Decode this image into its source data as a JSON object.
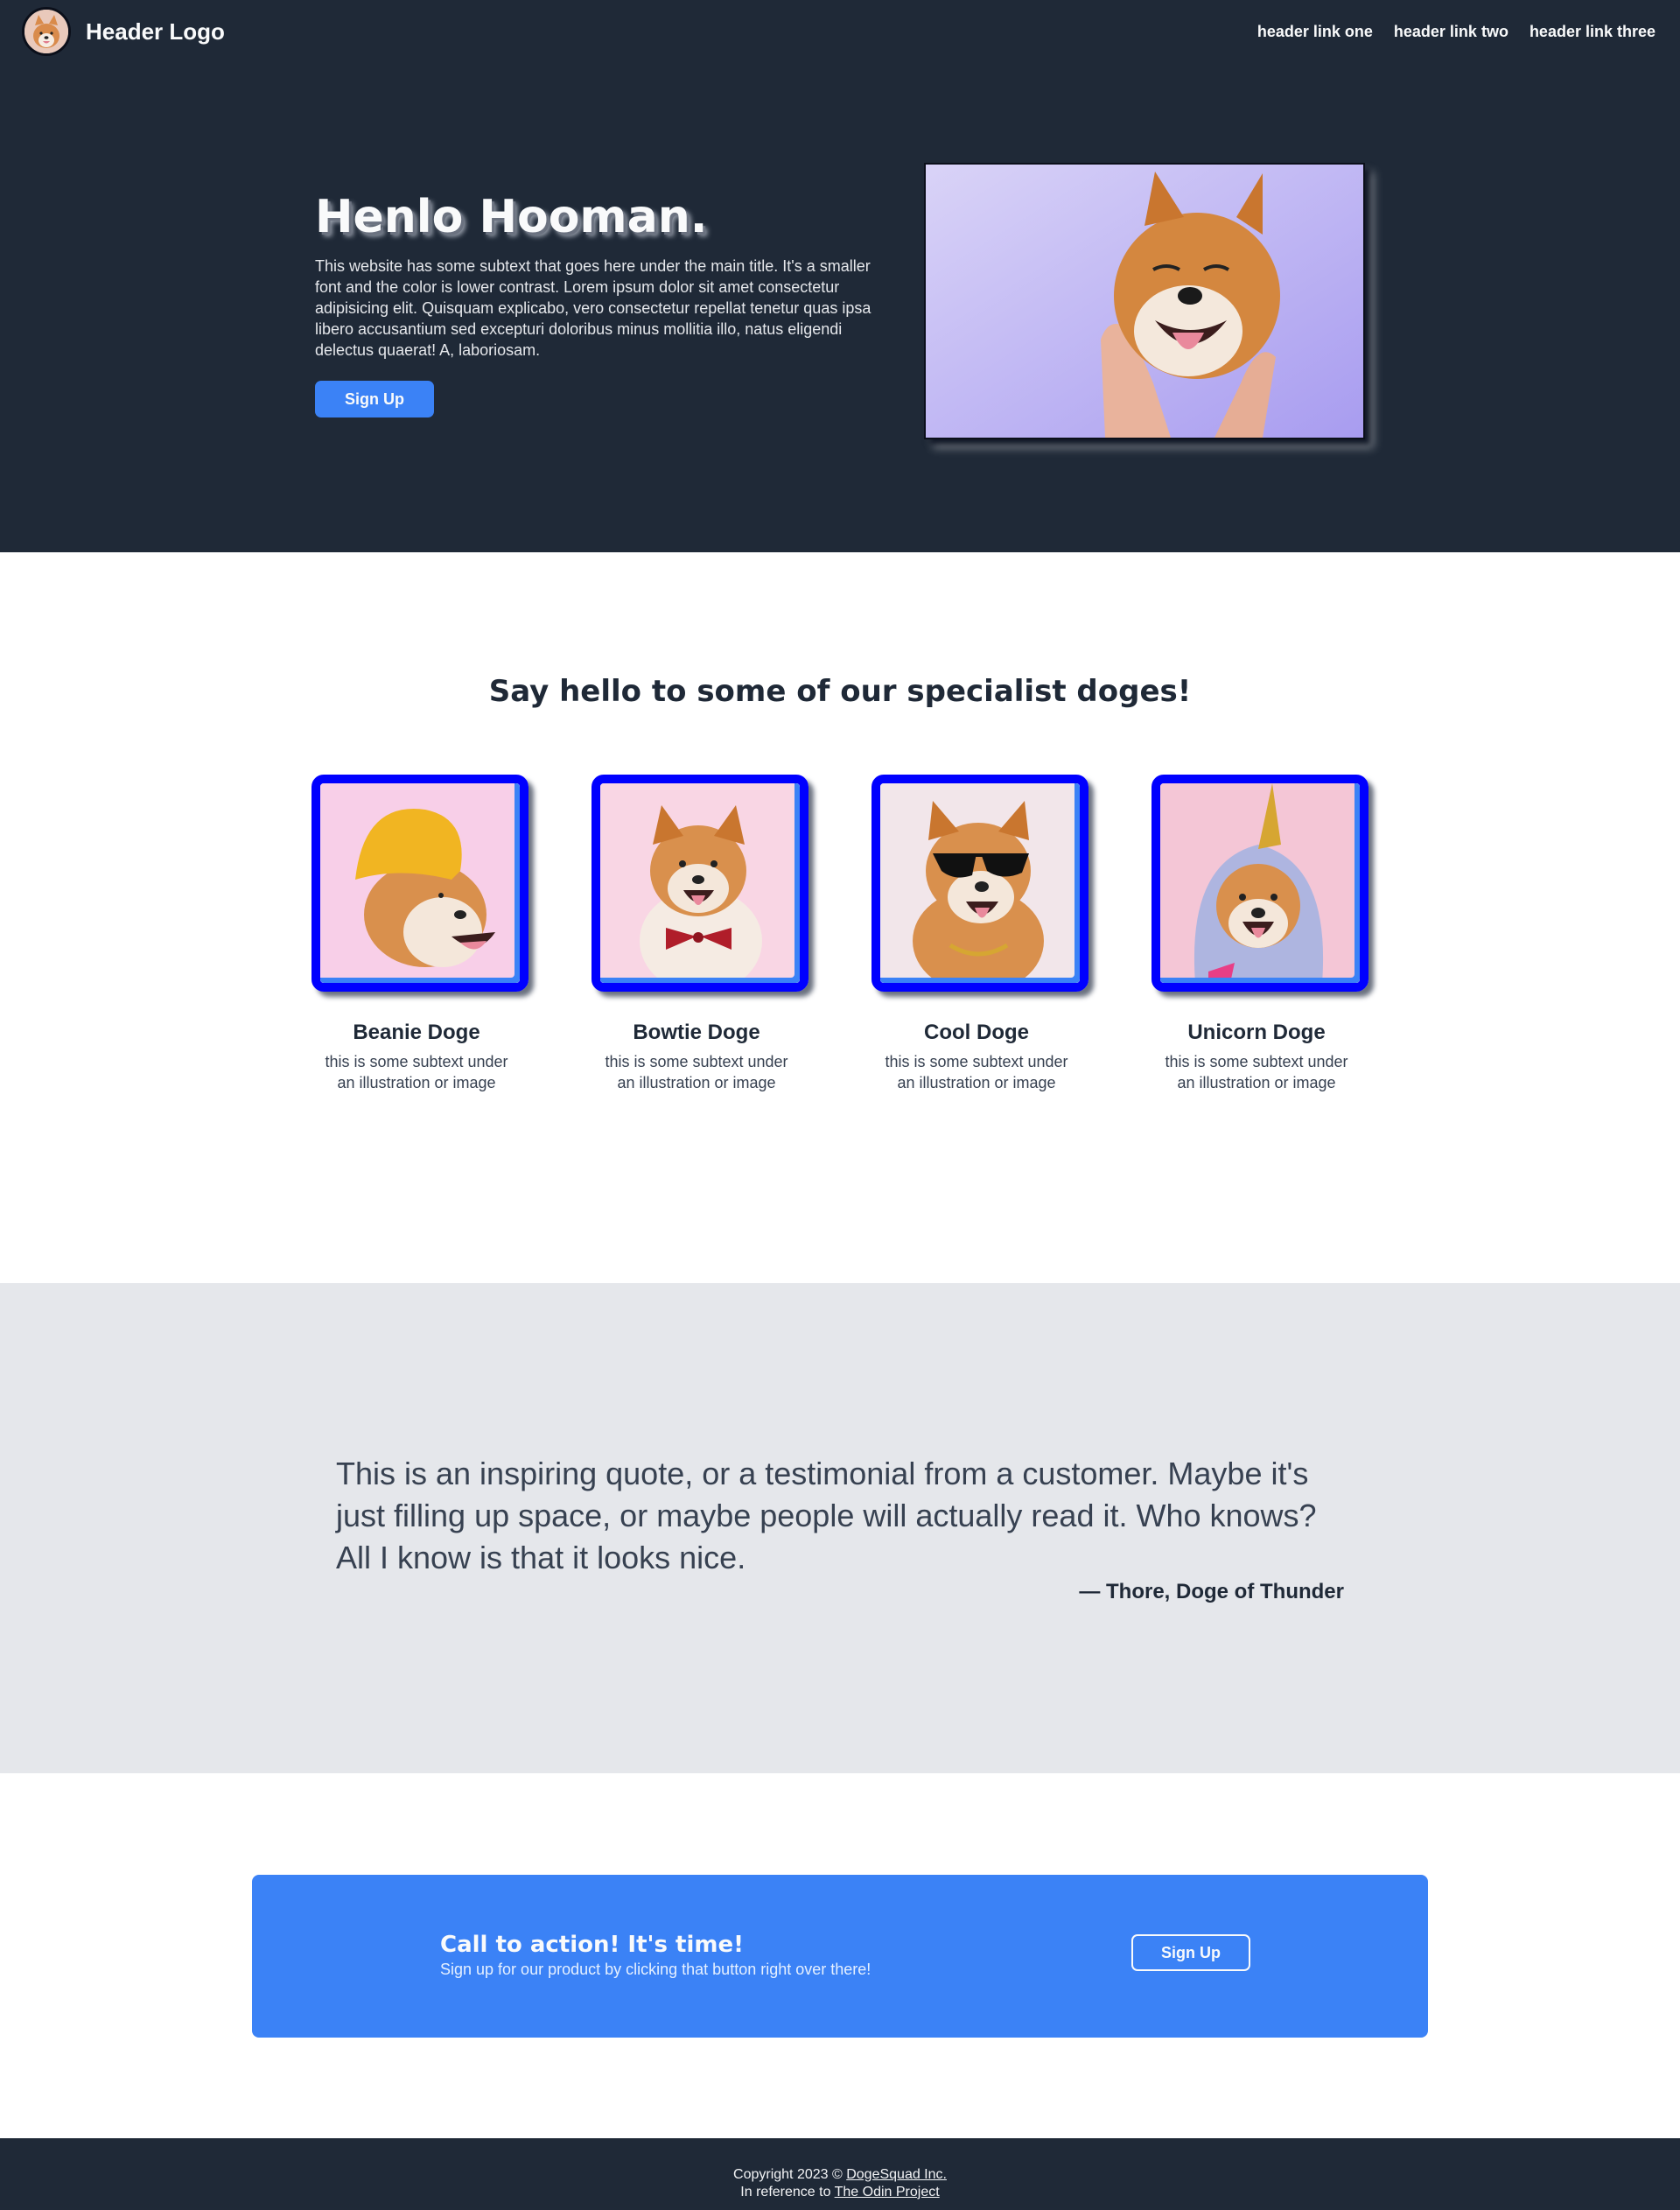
{
  "header": {
    "logo_text": "Header Logo",
    "nav": [
      "header link one",
      "header link two",
      "header link three"
    ]
  },
  "hero": {
    "title": "Henlo Hooman.",
    "subtext": "This website has some subtext that goes here under the main title. It's a smaller font and the color is lower contrast. Lorem ipsum dolor sit amet consectetur adipisicing elit. Quisquam explicabo, vero consectetur repellat tenetur quas ipsa libero accusantium sed excepturi doloribus minus mollitia illo, natus eligendi delectus quaerat! A, laboriosam.",
    "button": "Sign Up"
  },
  "specialists": {
    "title": "Say hello to some of our specialist doges!",
    "cards": [
      {
        "name": "Beanie Doge",
        "sub": "this is some subtext under an illustration or image"
      },
      {
        "name": "Bowtie Doge",
        "sub": "this is some subtext under an illustration or image"
      },
      {
        "name": "Cool Doge",
        "sub": "this is some subtext under an illustration or image"
      },
      {
        "name": "Unicorn Doge",
        "sub": "this is some subtext under an illustration or image"
      }
    ]
  },
  "quote": {
    "text": "This is an inspiring quote, or a testimonial from a customer. Maybe it's just filling up space, or maybe people will actually read it. Who knows? All I know is that it looks nice.",
    "author": "— Thore, Doge of Thunder"
  },
  "cta": {
    "title": "Call to action! It's time!",
    "sub": "Sign up for our product by clicking that button right over there!",
    "button": "Sign Up"
  },
  "footer": {
    "copyright_prefix": "Copyright 2023 © ",
    "company": "DogeSquad Inc.",
    "reference_prefix": "In reference to ",
    "reference_link": "The Odin Project"
  },
  "colors": {
    "dark": "#1f2937",
    "accent": "#3b82f6",
    "card_border": "#0000ff",
    "quote_bg": "#e5e7eb"
  }
}
